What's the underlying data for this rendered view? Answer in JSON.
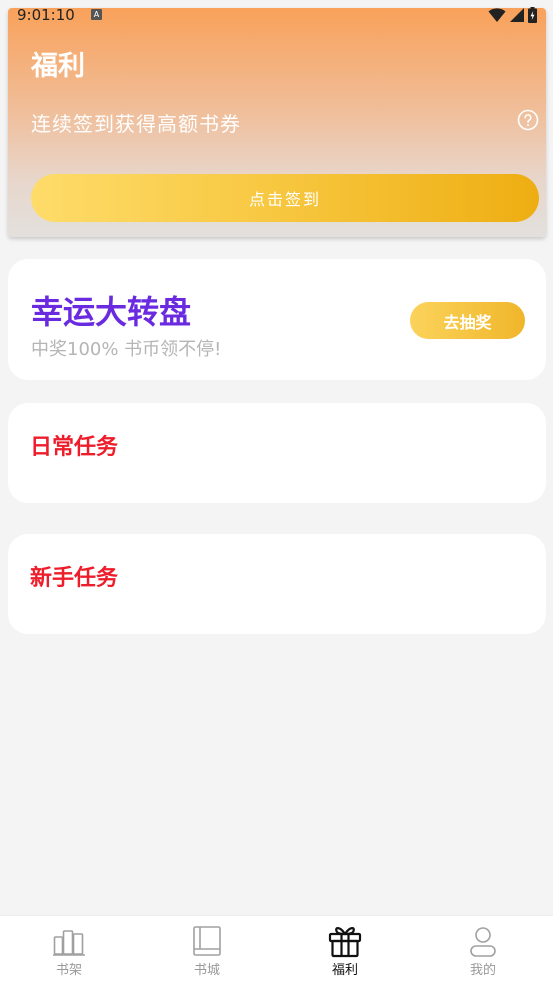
{
  "status_bar": {
    "time": "9:01:10",
    "indicator": "A"
  },
  "header": {
    "title": "福利",
    "subtitle": "连续签到获得高额书券",
    "signin_label": "点击签到"
  },
  "lottery": {
    "title": "幸运大转盘",
    "subtitle": "中奖100% 书币领不停!",
    "button_label": "去抽奖"
  },
  "daily_tasks": {
    "title": "日常任务"
  },
  "newbie_tasks": {
    "title": "新手任务"
  },
  "bottom_nav": {
    "items": [
      {
        "label": "书架",
        "icon": "bookshelf-icon"
      },
      {
        "label": "书城",
        "icon": "book-icon"
      },
      {
        "label": "福利",
        "icon": "gift-icon",
        "active": true
      },
      {
        "label": "我的",
        "icon": "profile-icon"
      }
    ]
  },
  "colors": {
    "lottery_title": "#6a2be0",
    "task_title": "#ee1d2b",
    "accent_gold": "#f0b62a"
  }
}
